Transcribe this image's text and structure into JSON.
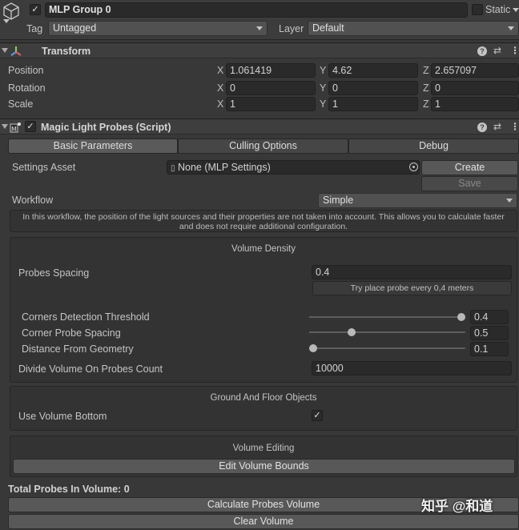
{
  "object": {
    "name": "MLP Group 0",
    "static_label": "Static",
    "tag_label": "Tag",
    "tag_value": "Untagged",
    "layer_label": "Layer",
    "layer_value": "Default"
  },
  "transform": {
    "title": "Transform",
    "rows": [
      {
        "label": "Position",
        "x": "1.061419",
        "y": "4.62",
        "z": "2.657097"
      },
      {
        "label": "Rotation",
        "x": "0",
        "y": "0",
        "z": "0"
      },
      {
        "label": "Scale",
        "x": "1",
        "y": "1",
        "z": "1"
      }
    ],
    "axis": {
      "x": "X",
      "y": "Y",
      "z": "Z"
    }
  },
  "script": {
    "title": "Magic Light Probes (Script)",
    "tabs": [
      "Basic Parameters",
      "Culling Options",
      "Debug"
    ],
    "settings_asset_label": "Settings Asset",
    "settings_asset_value": "None (MLP Settings)",
    "create_label": "Create",
    "save_label": "Save",
    "workflow_label": "Workflow",
    "workflow_value": "Simple",
    "workflow_help": "In this workflow, the position of the light sources and their properties are not taken into account. This allows you to calculate faster and does not require additional configuration.",
    "volume_density": {
      "header": "Volume Density",
      "probes_spacing_label": "Probes Spacing",
      "probes_spacing_value": "0.4",
      "probes_spacing_hint": "Try place probe every 0,4 meters",
      "sliders": [
        {
          "label": "Corners Detection Threshold",
          "value": "0.4",
          "fraction": 1.0
        },
        {
          "label": "Corner Probe Spacing",
          "value": "0.5",
          "fraction": 0.26
        },
        {
          "label": "Distance From Geometry",
          "value": "0.1",
          "fraction": 0.0
        }
      ],
      "divide_label": "Divide Volume On Probes Count",
      "divide_value": "10000"
    },
    "ground": {
      "header": "Ground And Floor Objects",
      "use_bottom_label": "Use Volume Bottom",
      "use_bottom_checked": true
    },
    "editing": {
      "header": "Volume Editing",
      "edit_bounds_label": "Edit Volume Bounds"
    },
    "total_label": "Total Probes In Volume: 0",
    "calculate_label": "Calculate Probes Volume",
    "clear_label": "Clear Volume"
  },
  "watermark": "知乎 @和道",
  "colors": {
    "background": "#383838",
    "field": "#2a2a2a",
    "button": "#585858",
    "active_tab": "#5a5a5a"
  }
}
